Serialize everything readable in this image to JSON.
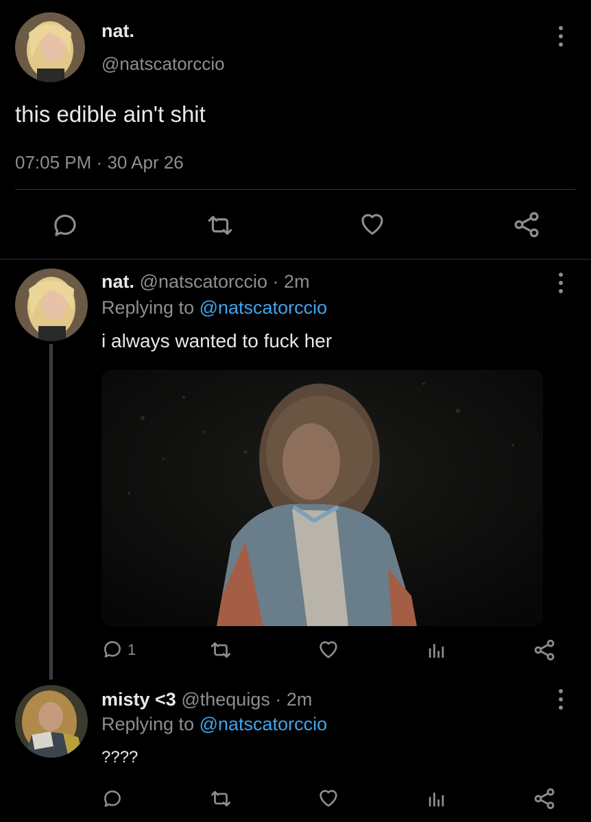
{
  "main_tweet": {
    "display_name": "nat.",
    "handle": "@natscatorccio",
    "text": "this edible ain't shit",
    "timestamp": "07:05 PM",
    "dot": "·",
    "date": "30 Apr 26"
  },
  "reply1": {
    "display_name": "nat.",
    "handle": "@natscatorccio",
    "dot": "·",
    "time": "2m",
    "replying_prefix": "Replying to",
    "replying_handle": "@natscatorccio",
    "text": "i always wanted to fuck her",
    "reply_count": "1"
  },
  "reply2": {
    "display_name": "misty <3",
    "handle": "@thequigs",
    "dot": "·",
    "time": "2m",
    "replying_prefix": "Replying to",
    "replying_handle": "@natscatorccio",
    "text": "????"
  },
  "icons": [
    "reply-icon",
    "retweet-icon",
    "like-icon",
    "share-icon",
    "views-icon",
    "more-icon"
  ],
  "colors": {
    "background": "#000000",
    "link": "#3ea6f0",
    "muted": "#8b8f94",
    "text": "#e7e9ea"
  }
}
